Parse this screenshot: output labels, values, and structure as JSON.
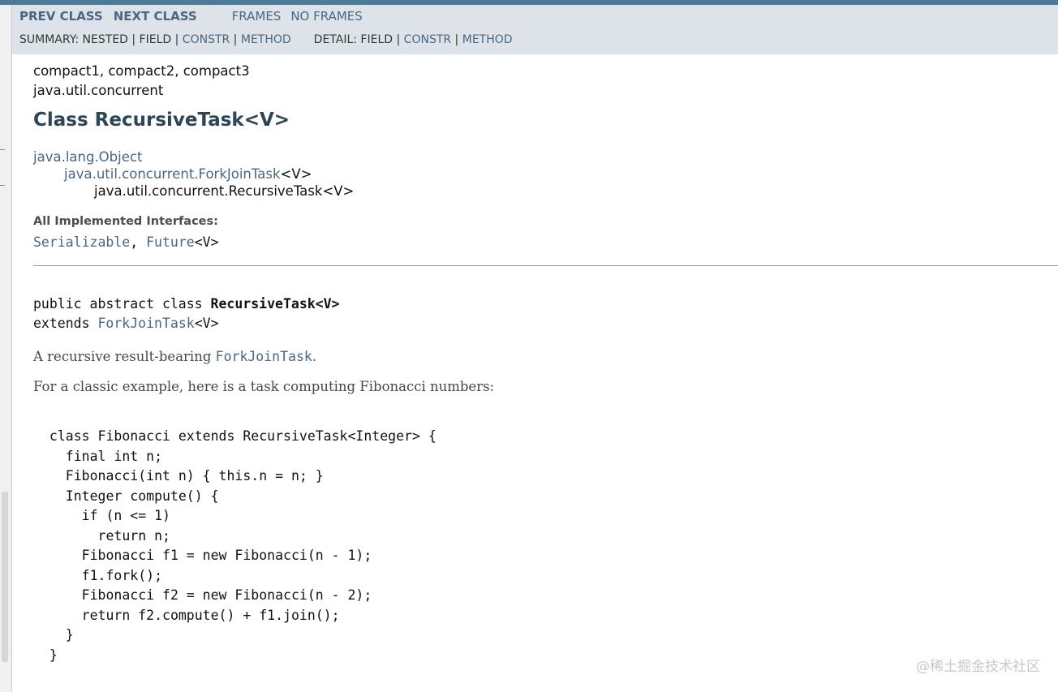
{
  "nav": {
    "prev_class": "PREV CLASS",
    "next_class": "NEXT CLASS",
    "frames": "FRAMES",
    "no_frames": "NO FRAMES",
    "summary_label": "SUMMARY: NESTED | FIELD | ",
    "summary_constr": "CONSTR",
    "summary_sep": " | ",
    "summary_method": "METHOD",
    "detail_label": "DETAIL: FIELD | ",
    "detail_constr": "CONSTR",
    "detail_sep": " | ",
    "detail_method": "METHOD"
  },
  "header": {
    "profiles": "compact1, compact2, compact3",
    "package": "java.util.concurrent",
    "title": "Class RecursiveTask<V>"
  },
  "inheritance": {
    "level1": "java.lang.Object",
    "level2_link": "java.util.concurrent.ForkJoinTask",
    "level2_suffix": "<V>",
    "level3": "java.util.concurrent.RecursiveTask<V>"
  },
  "interfaces": {
    "label": "All Implemented Interfaces:",
    "item1": "Serializable",
    "comma": ", ",
    "item2": "Future",
    "item2_suffix": "<V>"
  },
  "signature": {
    "line1_prefix": "public abstract class ",
    "line1_name": "RecursiveTask<V>",
    "line2_prefix": "extends ",
    "line2_link": "ForkJoinTask",
    "line2_suffix": "<V>"
  },
  "description": {
    "p1_prefix": "A recursive result-bearing ",
    "p1_link": "ForkJoinTask",
    "p1_suffix": ".",
    "p2": "For a classic example, here is a task computing Fibonacci numbers:"
  },
  "code_example": " class Fibonacci extends RecursiveTask<Integer> {\n   final int n;\n   Fibonacci(int n) { this.n = n; }\n   Integer compute() {\n     if (n <= 1)\n       return n;\n     Fibonacci f1 = new Fibonacci(n - 1);\n     f1.fork();\n     Fibonacci f2 = new Fibonacci(n - 2);\n     return f2.compute() + f1.join();\n   }\n }",
  "watermark": "@稀土掘金技术社区"
}
